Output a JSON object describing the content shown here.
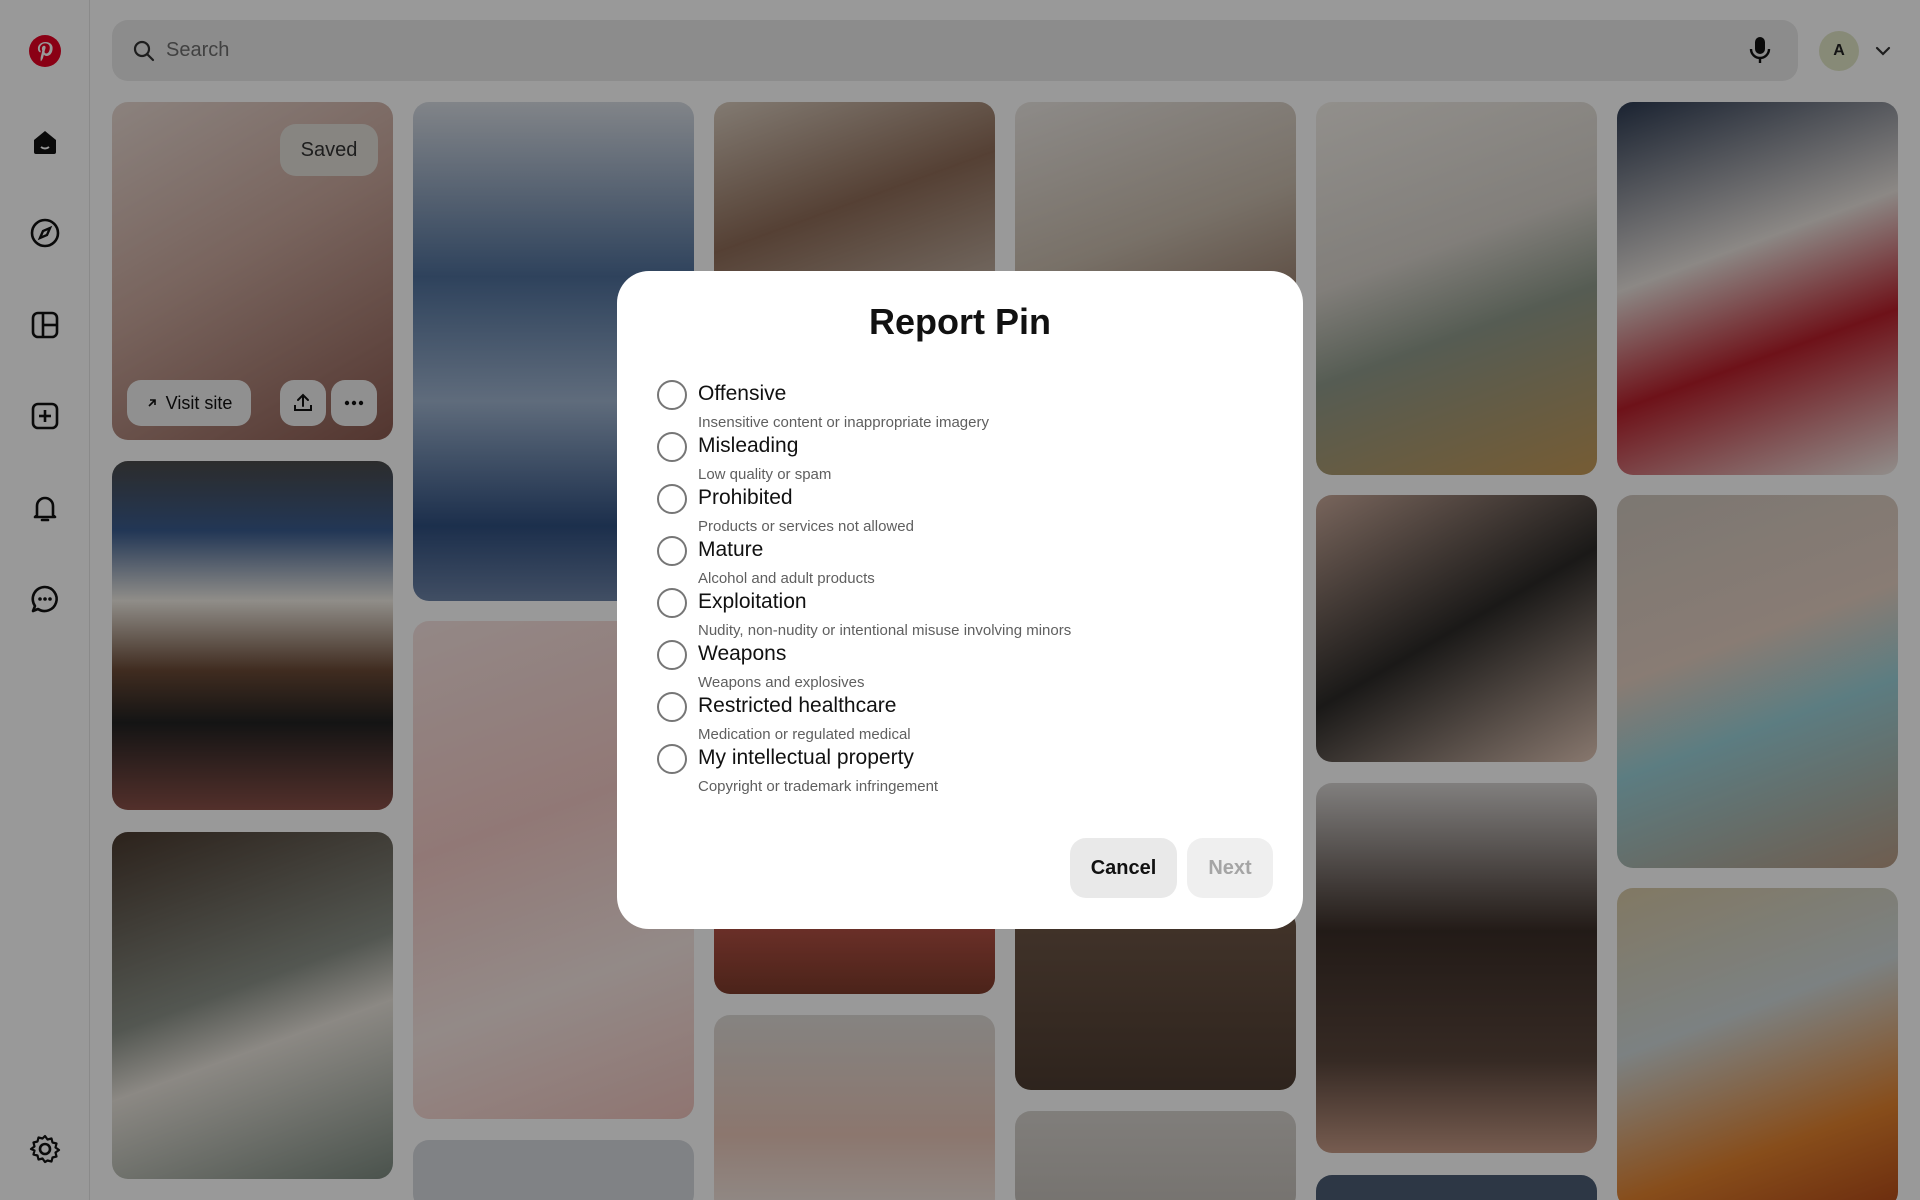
{
  "search": {
    "placeholder": "Search"
  },
  "user": {
    "avatar_initial": "A"
  },
  "sidebar": {
    "icons": [
      "pinterest-logo-icon",
      "home-icon",
      "explore-icon",
      "boards-icon",
      "create-icon",
      "notifications-icon",
      "messages-icon",
      "settings-icon"
    ]
  },
  "pin_hover": {
    "saved_label": "Saved",
    "visit_label": "Visit site"
  },
  "modal": {
    "title": "Report Pin",
    "options": [
      {
        "label": "Offensive",
        "description": "Insensitive content or inappropriate imagery"
      },
      {
        "label": "Misleading",
        "description": "Low quality or spam"
      },
      {
        "label": "Prohibited",
        "description": "Products or services not allowed"
      },
      {
        "label": "Mature",
        "description": "Alcohol and adult products"
      },
      {
        "label": "Exploitation",
        "description": "Nudity, non-nudity or intentional misuse involving minors"
      },
      {
        "label": "Weapons",
        "description": "Weapons and explosives"
      },
      {
        "label": "Restricted healthcare",
        "description": "Medication or regulated medical"
      },
      {
        "label": "My intellectual property",
        "description": "Copyright or trademark infringement"
      }
    ],
    "cancel_label": "Cancel",
    "next_label": "Next"
  },
  "colors": {
    "brand": "#e60023",
    "overlay": "rgba(0,0,0,0.40)"
  }
}
